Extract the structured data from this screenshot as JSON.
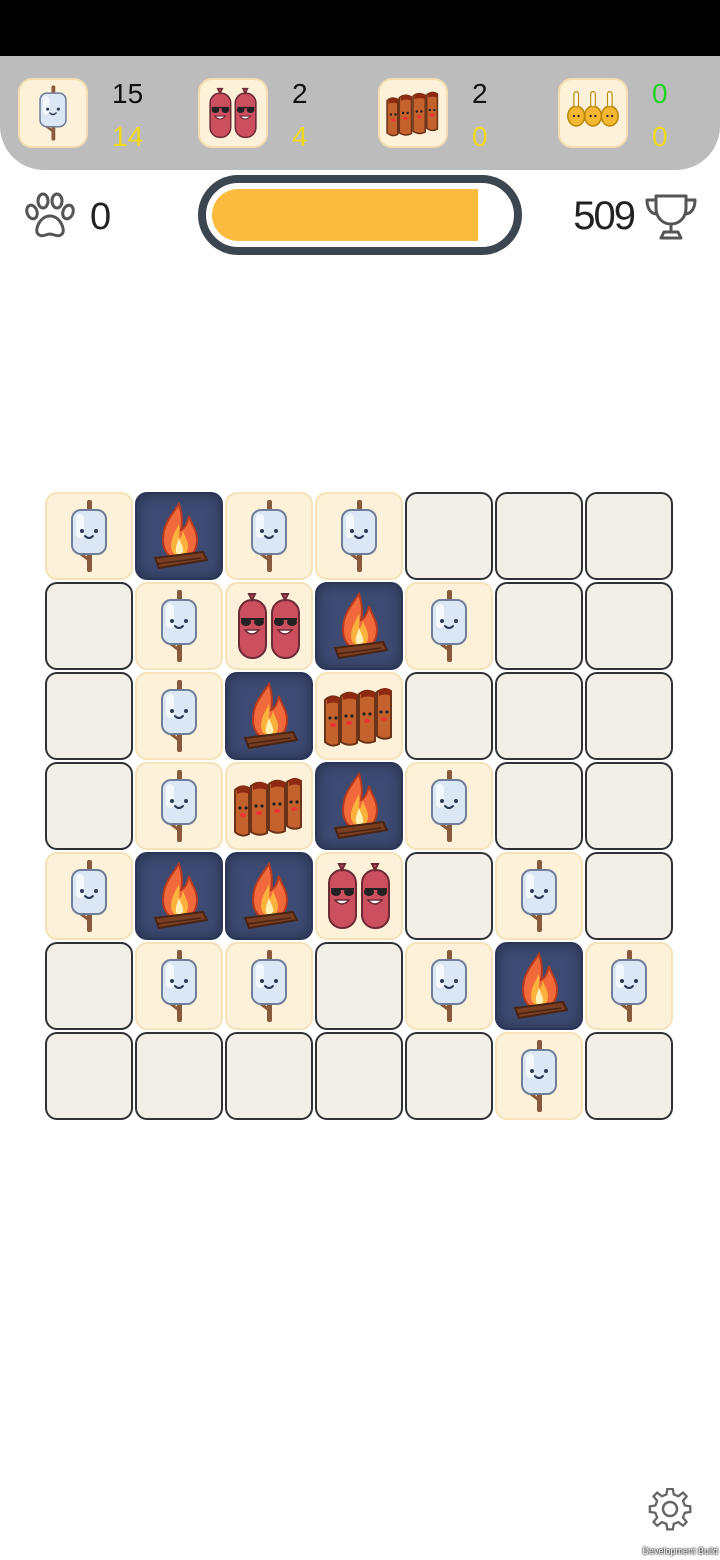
{
  "goals": [
    {
      "icon": "marshmallow-icon",
      "target": "15",
      "current": "14"
    },
    {
      "icon": "sausage-icon",
      "target": "2",
      "current": "4"
    },
    {
      "icon": "ribs-icon",
      "target": "2",
      "current": "0"
    },
    {
      "icon": "drumstick-icon",
      "target": "0",
      "current": "0"
    }
  ],
  "moves": "0",
  "progress": 0.9,
  "score": "509",
  "board": [
    [
      "marshmallow",
      "fire",
      "marshmallow",
      "marshmallow",
      "empty",
      "empty",
      "empty"
    ],
    [
      "empty",
      "marshmallow",
      "sausage",
      "fire",
      "marshmallow",
      "empty",
      "empty"
    ],
    [
      "empty",
      "marshmallow",
      "fire",
      "ribs",
      "empty",
      "empty",
      "empty"
    ],
    [
      "empty",
      "marshmallow",
      "ribs",
      "fire",
      "marshmallow",
      "empty",
      "empty"
    ],
    [
      "marshmallow",
      "fire",
      "fire",
      "sausage",
      "empty",
      "marshmallow",
      "empty"
    ],
    [
      "empty",
      "marshmallow",
      "marshmallow",
      "empty",
      "marshmallow",
      "fire",
      "marshmallow"
    ],
    [
      "empty",
      "empty",
      "empty",
      "empty",
      "empty",
      "marshmallow",
      "empty"
    ]
  ],
  "dev_label": "Development Build",
  "colors": {
    "progress": "#fbbb3e",
    "goal_met": "#1fd41f",
    "goal_current": "#f0d81a",
    "fire_tile": "#3d4a72"
  }
}
